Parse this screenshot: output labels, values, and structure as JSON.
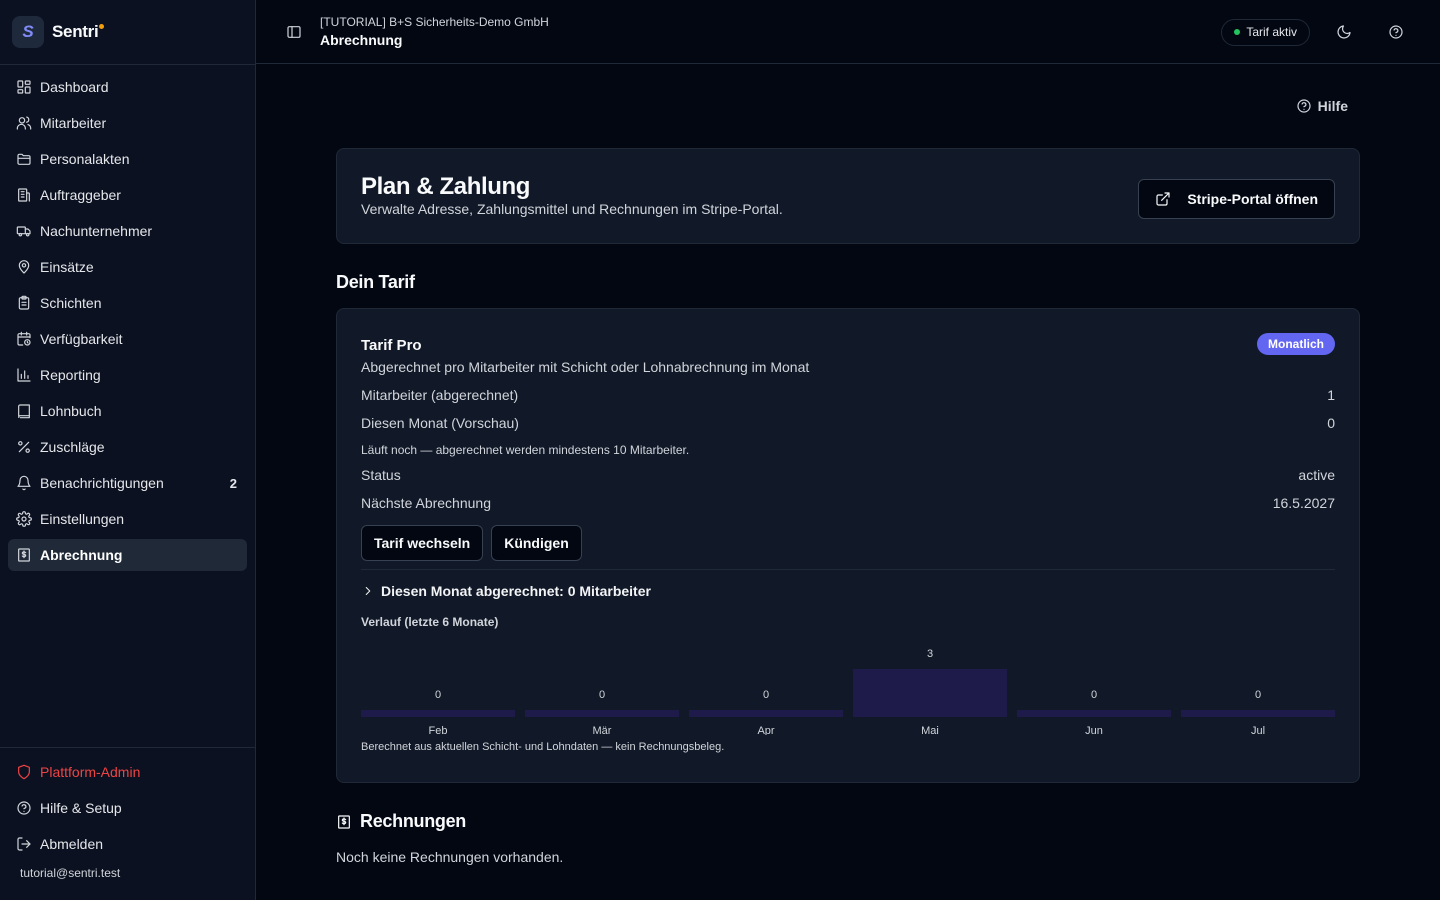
{
  "app": {
    "name": "Sentri",
    "logo_letter": "S",
    "accent": "#6366f1",
    "logo_color": "#818cf8",
    "brand_dot_color": "#f59e0b"
  },
  "sidebar": {
    "items": [
      {
        "label": "Dashboard",
        "icon": "dashboard-icon"
      },
      {
        "label": "Mitarbeiter",
        "icon": "users-icon"
      },
      {
        "label": "Personalakten",
        "icon": "folder-icon"
      },
      {
        "label": "Auftraggeber",
        "icon": "building-icon"
      },
      {
        "label": "Nachunternehmer",
        "icon": "truck-icon"
      },
      {
        "label": "Einsätze",
        "icon": "map-pin-icon"
      },
      {
        "label": "Schichten",
        "icon": "clipboard-icon"
      },
      {
        "label": "Verfügbarkeit",
        "icon": "calendar-clock-icon"
      },
      {
        "label": "Reporting",
        "icon": "bar-chart-icon"
      },
      {
        "label": "Lohnbuch",
        "icon": "book-icon"
      },
      {
        "label": "Zuschläge",
        "icon": "percent-icon"
      },
      {
        "label": "Benachrichtigungen",
        "icon": "bell-icon",
        "badge": "2"
      },
      {
        "label": "Einstellungen",
        "icon": "gear-icon"
      },
      {
        "label": "Abrechnung",
        "icon": "receipt-icon",
        "active": true
      }
    ],
    "bottom": [
      {
        "label": "Plattform-Admin",
        "icon": "shield-icon",
        "color": "#ef4444"
      },
      {
        "label": "Hilfe & Setup",
        "icon": "help-circle-icon"
      },
      {
        "label": "Abmelden",
        "icon": "logout-icon"
      }
    ],
    "user_email": "tutorial@sentri.test"
  },
  "header": {
    "org": "[TUTORIAL] B+S Sicherheits-Demo GmbH",
    "page": "Abrechnung",
    "status": "Tarif aktiv",
    "status_color": "#22c55e"
  },
  "main": {
    "help_label": "Hilfe",
    "plan": {
      "title": "Plan & Zahlung",
      "subtitle": "Verwalte Adresse, Zahlungsmittel und Rechnungen im Stripe-Portal.",
      "portal_button": "Stripe-Portal öffnen"
    },
    "tarif_section_title": "Dein Tarif",
    "tarif": {
      "name": "Tarif Pro",
      "badge": "Monatlich",
      "description": "Abgerechnet pro Mitarbeiter mit Schicht oder Lohnabrechnung im Monat",
      "rows": [
        {
          "label": "Mitarbeiter (abgerechnet)",
          "value": "1"
        },
        {
          "label": "Diesen Monat (Vorschau)",
          "value": "0"
        }
      ],
      "note": "Läuft noch — abgerechnet werden mindestens 10 Mitarbeiter.",
      "rows2": [
        {
          "label": "Status",
          "value": "active"
        },
        {
          "label": "Nächste Abrechnung",
          "value": "16.5.2027"
        }
      ],
      "change_button": "Tarif wechseln",
      "cancel_button": "Kündigen",
      "collapse_label": "Diesen Monat abgerechnet: 0 Mitarbeiter",
      "history_title": "Verlauf (letzte 6 Monate)",
      "chart_note": "Berechnet aus aktuellen Schicht- und Lohndaten — kein Rechnungsbeleg."
    },
    "invoices": {
      "title": "Rechnungen",
      "empty": "Noch keine Rechnungen vorhanden."
    }
  },
  "chart_data": {
    "type": "bar",
    "title": "Verlauf (letzte 6 Monate)",
    "categories": [
      "Feb",
      "Mär",
      "Apr",
      "Mai",
      "Jun",
      "Jul"
    ],
    "values": [
      0,
      0,
      0,
      3,
      0,
      0
    ],
    "ylim": [
      0,
      3
    ],
    "grid": false,
    "bar_color": "#1e1b4b"
  }
}
